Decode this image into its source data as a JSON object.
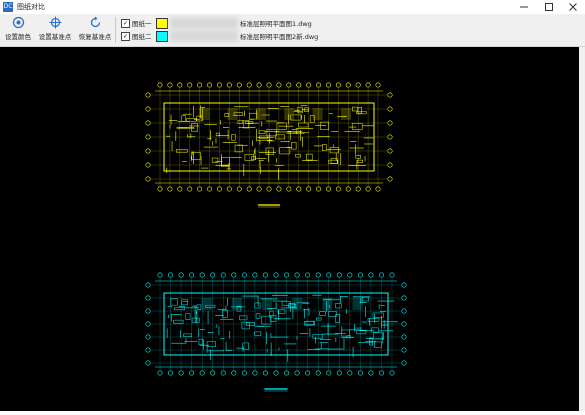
{
  "window": {
    "title": "图纸对比",
    "app_icon": "DC"
  },
  "toolbar": {
    "buttons": [
      {
        "label": "设置颜色",
        "icon": "color-settings-icon"
      },
      {
        "label": "设置基准点",
        "icon": "crosshair-icon"
      },
      {
        "label": "恢复基准点",
        "icon": "reset-icon"
      }
    ],
    "drawings": [
      {
        "label": "图纸一",
        "checked": true,
        "color": "#ffff00",
        "filename": "标准层照明平面图1.dwg"
      },
      {
        "label": "图纸二",
        "checked": true,
        "color": "#00ffff",
        "filename": "标准层照明平面图2新.dwg"
      }
    ]
  },
  "canvas": {
    "background": "#000000"
  }
}
